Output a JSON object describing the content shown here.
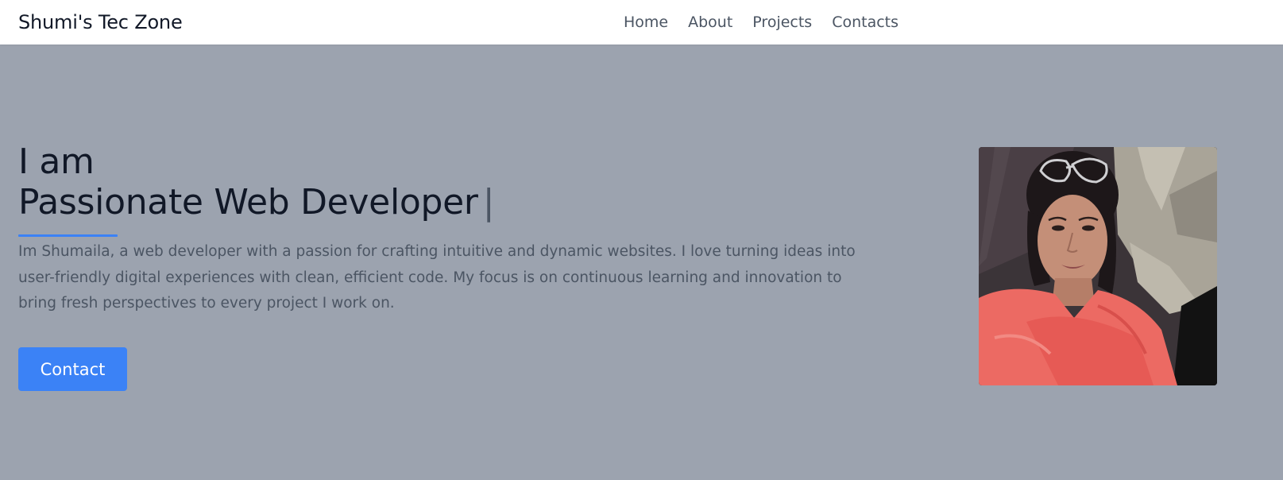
{
  "header": {
    "brand": "Shumi's Tec Zone",
    "nav": [
      "Home",
      "About",
      "Projects",
      "Contacts"
    ]
  },
  "hero": {
    "heading_line1": "I am",
    "heading_line2": "Passionate Web Developer",
    "cursor": "|",
    "bio": "Im Shumaila, a web developer with a passion for crafting intuitive and dynamic websites. I love turning ideas into user-friendly digital experiences with clean, efficient code. My focus is on continuous learning and innovation to bring fresh perspectives to every project I work on.",
    "contact_button": "Contact"
  },
  "colors": {
    "hero_bg": "#9ca3af",
    "accent": "#3b82f6",
    "heading": "#111827",
    "body_text": "#4b5563"
  }
}
